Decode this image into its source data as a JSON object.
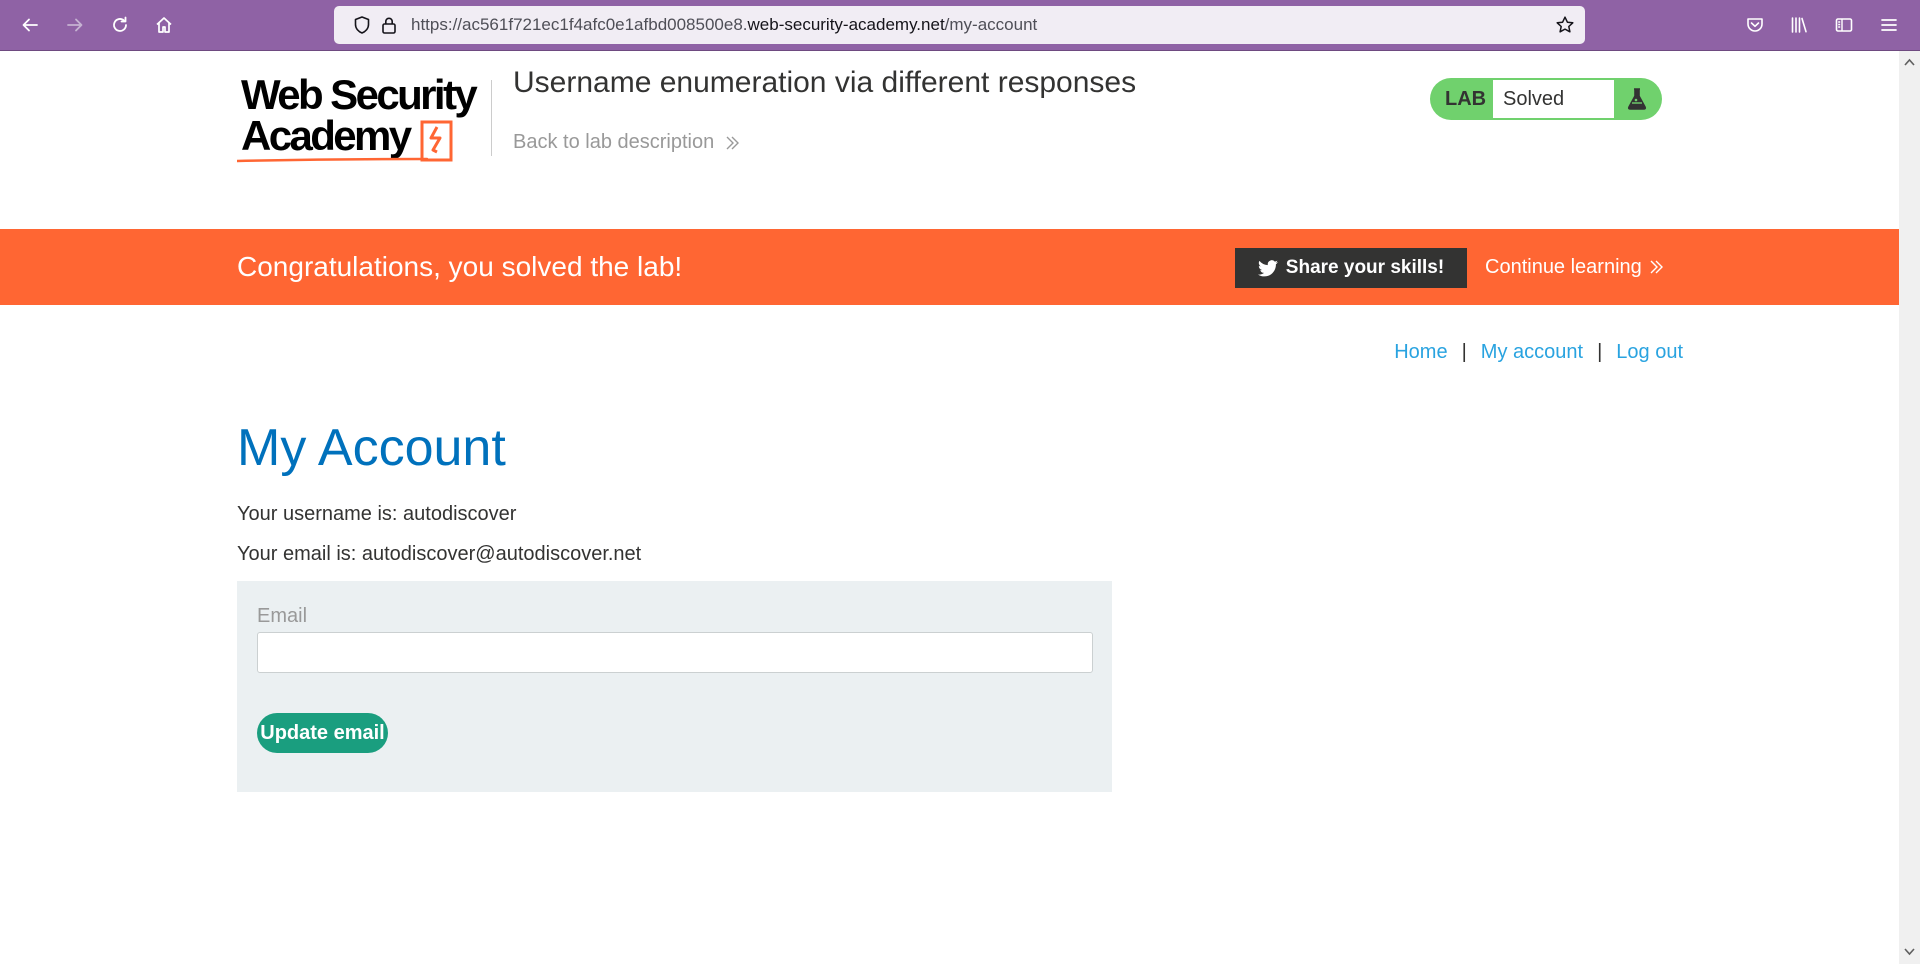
{
  "browser": {
    "url_prefix": "https://ac561f721ec1f4afc0e1afbd008500e8.",
    "url_domain": "web-security-academy.net",
    "url_path": "/my-account",
    "chrome_color": "#8f62a5"
  },
  "header": {
    "logo_line1": "Web Security",
    "logo_line2": "Academy",
    "lab_title": "Username enumeration via different responses",
    "back_link": "Back to lab description",
    "lab_badge_label": "LAB",
    "lab_status": "Solved",
    "badge_color": "#70d16d"
  },
  "banner": {
    "message": "Congratulations, you solved the lab!",
    "share_button": "Share your skills!",
    "continue_link": "Continue learning",
    "color": "#ff6633"
  },
  "nav": {
    "home": "Home",
    "separator": "|",
    "my_account": "My account",
    "log_out": "Log out"
  },
  "account": {
    "title": "My Account",
    "username_line": "Your username is: autodiscover",
    "email_line": "Your email is: autodiscover@autodiscover.net"
  },
  "form": {
    "email_label": "Email",
    "email_value": "",
    "update_button": "Update email"
  },
  "icons": {
    "back": "arrow-left-icon",
    "forward": "arrow-right-icon",
    "reload": "reload-icon",
    "home": "home-icon",
    "shield": "shield-icon",
    "lock": "lock-icon",
    "bookmark": "star-icon",
    "pocket": "pocket-icon",
    "library": "library-icon",
    "sidebar": "sidebar-icon",
    "menu": "hamburger-menu-icon",
    "twitter": "twitter-icon",
    "flask": "flask-icon"
  }
}
